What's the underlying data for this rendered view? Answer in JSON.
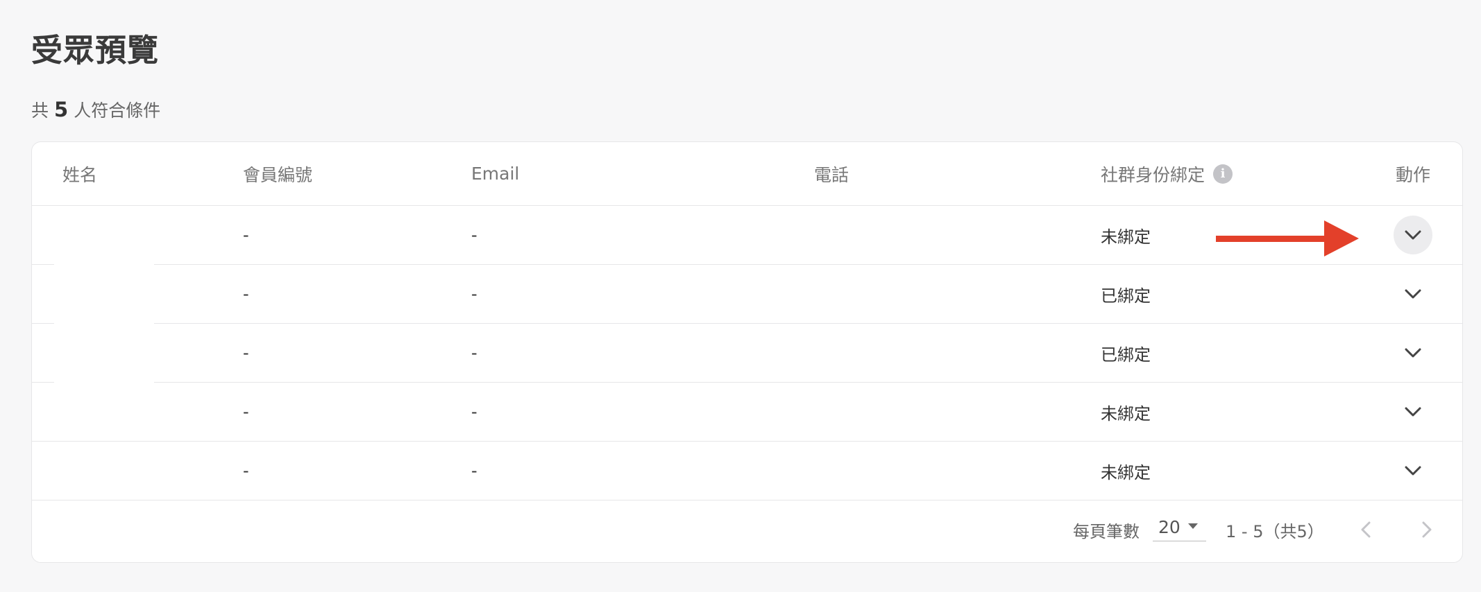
{
  "page": {
    "title": "受眾預覽"
  },
  "summary": {
    "prefix": "共",
    "count": "5",
    "suffix": "人符合條件"
  },
  "table": {
    "headers": {
      "name": "姓名",
      "member_id": "會員編號",
      "email": "Email",
      "phone": "電話",
      "social": "社群身份綁定",
      "action": "動作"
    },
    "rows": [
      {
        "name": "",
        "member_id": "-",
        "email": "-",
        "phone": "",
        "social": "未綁定",
        "action_icon": "chevron-down-icon"
      },
      {
        "name": "",
        "member_id": "-",
        "email": "-",
        "phone": "",
        "social": "已綁定",
        "action_icon": "chevron-down-icon"
      },
      {
        "name": "",
        "member_id": "-",
        "email": "-",
        "phone": "",
        "social": "已綁定",
        "action_icon": "chevron-down-icon"
      },
      {
        "name": "",
        "member_id": "-",
        "email": "-",
        "phone": "",
        "social": "未綁定",
        "action_icon": "chevron-down-icon"
      },
      {
        "name": "",
        "member_id": "-",
        "email": "-",
        "phone": "",
        "social": "未綁定",
        "action_icon": "chevron-down-icon"
      }
    ]
  },
  "pagination": {
    "per_page_label": "每頁筆數",
    "per_page_value": "20",
    "range_text": "1 - 5（共5）"
  },
  "colors": {
    "accent_arrow": "#e3402a",
    "border": "#e6e6e8",
    "background": "#f7f7f8",
    "info_icon": "#c3c3c7"
  }
}
